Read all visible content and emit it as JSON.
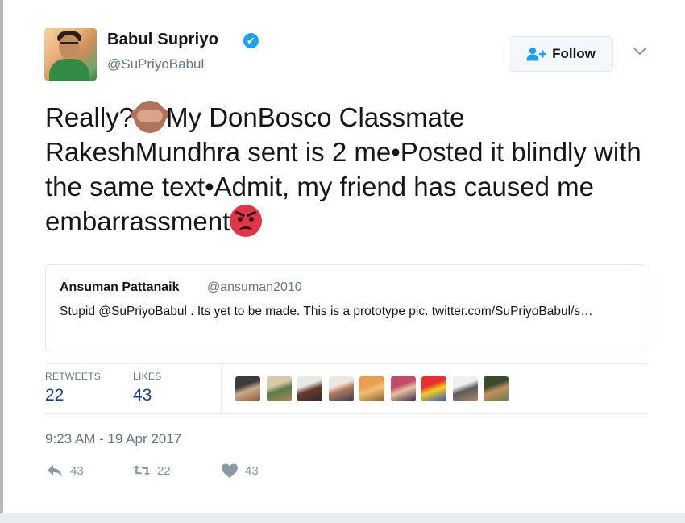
{
  "colors": {
    "accent": "#1da1f2",
    "stat_number": "#1b3c8c",
    "secondary_text": "#657786",
    "angry_emoji": "#e0364a",
    "monkey_emoji": "#b0735b"
  },
  "author": {
    "name": "Babul Supriyo",
    "handle": "@SuPriyoBabul",
    "verified_icon": "verified-badge-icon",
    "verified_mark": "✔",
    "avatar": "profile-photo"
  },
  "follow": {
    "label": "Follow",
    "icon": "add-user-icon"
  },
  "menu": {
    "icon": "chevron-down-icon"
  },
  "tweet": {
    "text_part1": "Really?",
    "emoji1": "see-no-evil-monkey-emoji",
    "text_part2": "My DonBosco Classmate RakeshMundhra sent is 2 me•Posted it blindly with the same text•Admit, my friend has caused me embarrassment",
    "emoji2": "angry-face-emoji"
  },
  "quoted_tweet": {
    "name": "Ansuman Pattanaik",
    "handle": "@ansuman2010",
    "text": "Stupid @SuPriyoBabul . Its yet to be made. This is a prototype pic. twitter.com/SuPriyoBabul/s…"
  },
  "stats": {
    "retweets_label": "RETWEETS",
    "retweets_value": "22",
    "likes_label": "LIKES",
    "likes_value": "43"
  },
  "likers": [
    {
      "name": "liker-avatar-1",
      "colors": [
        "#3b3b3b",
        "#c9a98a",
        "#8a5a3a"
      ]
    },
    {
      "name": "liker-avatar-2",
      "colors": [
        "#d8c9a8",
        "#5a7a4a",
        "#a88a5a"
      ]
    },
    {
      "name": "liker-avatar-3",
      "colors": [
        "#e8e8e8",
        "#6a3a2a",
        "#2a2a2a"
      ]
    },
    {
      "name": "liker-avatar-4",
      "colors": [
        "#f0e8e0",
        "#b07a5a",
        "#3a3a5a"
      ]
    },
    {
      "name": "liker-avatar-5",
      "colors": [
        "#e8a050",
        "#f0c070",
        "#8a5a30"
      ]
    },
    {
      "name": "liker-avatar-6",
      "colors": [
        "#c04a6a",
        "#e8c0a0",
        "#3a2a4a"
      ]
    },
    {
      "name": "liker-avatar-7",
      "colors": [
        "#e83030",
        "#f0d020",
        "#3050c0"
      ]
    },
    {
      "name": "liker-avatar-8",
      "colors": [
        "#f0f0f0",
        "#5a5a5a",
        "#b08a6a"
      ]
    },
    {
      "name": "liker-avatar-9",
      "colors": [
        "#3a4a2a",
        "#c09060",
        "#6a7a4a"
      ]
    }
  ],
  "timestamp": "9:23 AM - 19 Apr 2017",
  "actions": {
    "reply_count": "43",
    "reply_icon": "reply-icon",
    "retweet_count": "22",
    "retweet_icon": "retweet-icon",
    "like_count": "43",
    "like_icon": "heart-icon"
  }
}
